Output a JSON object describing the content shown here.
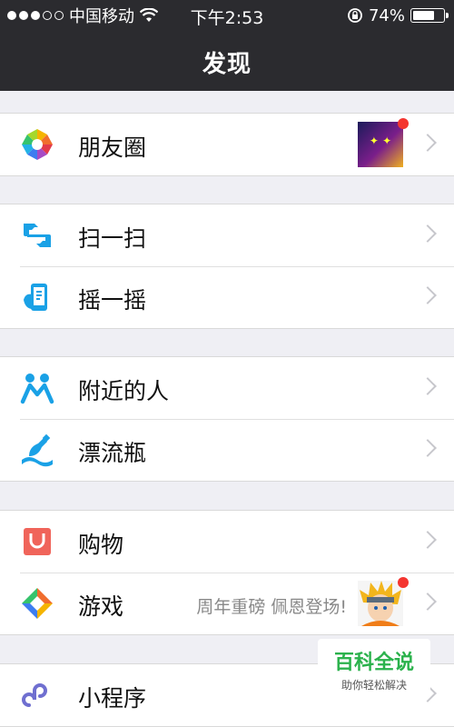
{
  "status_bar": {
    "carrier": "中国移动",
    "time": "下午2:53",
    "battery_percent": "74%",
    "battery_level": 0.74,
    "icons": [
      "signal-dots-icon",
      "wifi-icon",
      "rotation-lock-icon",
      "battery-icon"
    ]
  },
  "nav": {
    "title": "发现"
  },
  "groups": [
    {
      "items": [
        {
          "label": "朋友圈",
          "icon": "moments-icon",
          "has_thumbnail": true,
          "has_badge": true
        }
      ]
    },
    {
      "items": [
        {
          "label": "扫一扫",
          "icon": "scan-icon"
        },
        {
          "label": "摇一摇",
          "icon": "shake-icon"
        }
      ]
    },
    {
      "items": [
        {
          "label": "附近的人",
          "icon": "people-nearby-icon"
        },
        {
          "label": "漂流瓶",
          "icon": "drift-bottle-icon"
        }
      ]
    },
    {
      "items": [
        {
          "label": "购物",
          "icon": "shopping-icon"
        },
        {
          "label": "游戏",
          "icon": "games-icon",
          "subtext": "周年重磅 佩恩登场!",
          "has_avatar": true,
          "has_badge": true
        }
      ]
    },
    {
      "items": [
        {
          "label": "小程序",
          "icon": "mini-programs-icon"
        }
      ]
    }
  ],
  "watermark": {
    "title": "百科全说",
    "subtitle": "助你轻松解决"
  },
  "colors": {
    "nav_bg": "#2b2b2f",
    "page_bg": "#efeff4",
    "badge": "#f43530",
    "scan_blue": "#1aa1e6",
    "shop_red": "#f0645a"
  }
}
